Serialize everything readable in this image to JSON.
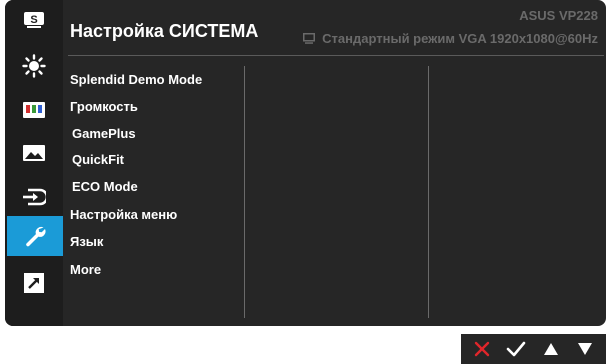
{
  "header": {
    "title": "Настройка СИСТЕМА",
    "model": "ASUS  VP228",
    "status": "Стандартный режим VGA 1920x1080@60Hz"
  },
  "sidebar": {
    "items": [
      {
        "icon": "splendid-s-icon",
        "label": "S"
      },
      {
        "icon": "brightness-icon"
      },
      {
        "icon": "color-bars-icon"
      },
      {
        "icon": "image-icon"
      },
      {
        "icon": "input-select-icon"
      },
      {
        "icon": "wrench-icon",
        "active": true
      },
      {
        "icon": "shortcut-arrow-icon"
      }
    ]
  },
  "menu": {
    "items": [
      "Splendid Demo Mode",
      "Громкость",
      "GamePlus",
      "QuickFit",
      "ECO Mode",
      "Настройка меню",
      "Язык",
      "More"
    ]
  },
  "keys": [
    {
      "icon": "close-x-icon",
      "color": "#e0262b"
    },
    {
      "icon": "check-icon",
      "color": "#ffffff"
    },
    {
      "icon": "up-arrow-icon",
      "color": "#ffffff"
    },
    {
      "icon": "down-arrow-icon",
      "color": "#ffffff"
    }
  ],
  "colors": {
    "accent": "#1b9bd7",
    "panel": "#262626",
    "header_text": "#ffffff",
    "muted_text": "#6a6a6a"
  }
}
